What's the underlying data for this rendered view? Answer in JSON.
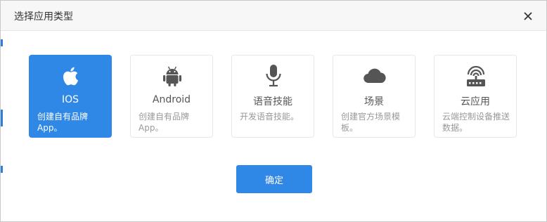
{
  "dialog": {
    "title": "选择应用类型",
    "confirm_label": "确定"
  },
  "colors": {
    "accent": "#2f87e6",
    "border": "#e6e6e6",
    "muted_text": "#999999"
  },
  "cards": [
    {
      "name": "IOS",
      "desc": "创建自有品牌App。",
      "icon": "apple-icon",
      "selected": true
    },
    {
      "name": "Android",
      "desc": "创建自有品牌App。",
      "icon": "android-icon",
      "selected": false
    },
    {
      "name": "语音技能",
      "desc": "开发语音技能。",
      "icon": "microphone-icon",
      "selected": false
    },
    {
      "name": "场景",
      "desc": "创建官方场景模板。",
      "icon": "cloud-icon",
      "selected": false
    },
    {
      "name": "云应用",
      "desc": "云端控制设备推送数据。",
      "icon": "router-icon",
      "selected": false
    }
  ]
}
